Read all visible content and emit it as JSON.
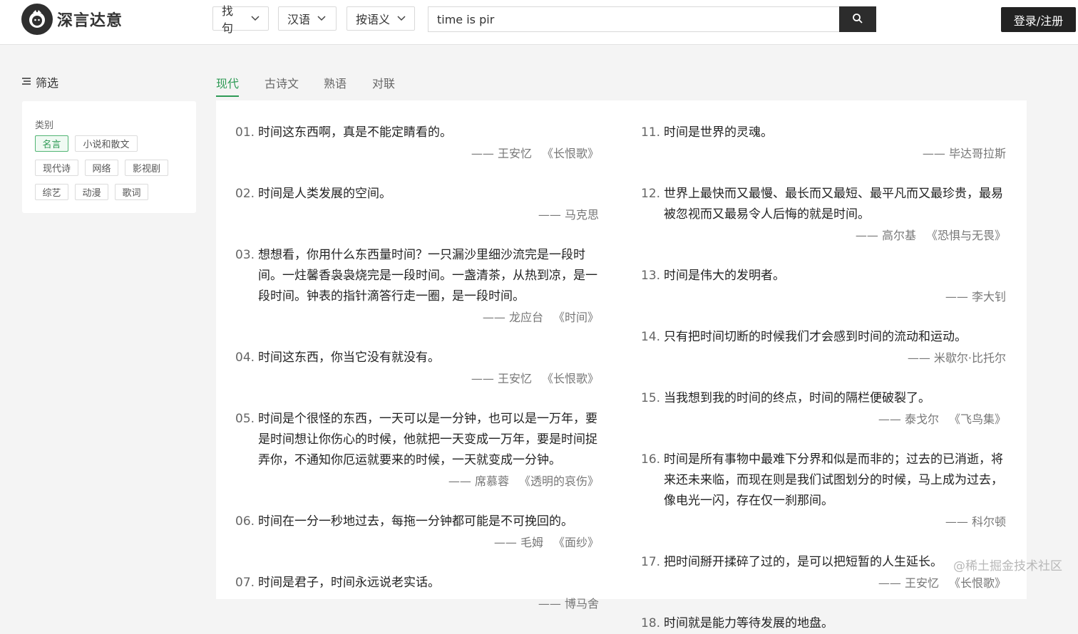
{
  "header": {
    "logo_text": "深言达意",
    "dropdowns": [
      "找句",
      "汉语",
      "按语义"
    ],
    "search_value": "time is pir",
    "login_label": "登录/注册"
  },
  "sidebar": {
    "filter_title": "筛选",
    "category_label": "类别",
    "tags": [
      {
        "label": "名言",
        "active": true
      },
      {
        "label": "小说和散文",
        "active": false
      },
      {
        "label": "现代诗",
        "active": false
      },
      {
        "label": "网络",
        "active": false
      },
      {
        "label": "影视剧",
        "active": false
      },
      {
        "label": "综艺",
        "active": false
      },
      {
        "label": "动漫",
        "active": false
      },
      {
        "label": "歌词",
        "active": false
      }
    ]
  },
  "tabs": [
    {
      "label": "现代",
      "active": true
    },
    {
      "label": "古诗文",
      "active": false
    },
    {
      "label": "熟语",
      "active": false
    },
    {
      "label": "对联",
      "active": false
    }
  ],
  "quotes_left": [
    {
      "num": "01.",
      "text": "时间这东西啊，真是不能定睛看的。",
      "author": "—— 王安忆",
      "book": "《长恨歌》"
    },
    {
      "num": "02.",
      "text": "时间是人类发展的空间。",
      "author": "—— 马克思",
      "book": ""
    },
    {
      "num": "03.",
      "text": "想想看，你用什么东西量时间？一只漏沙里细沙流完是一段时间。一炷馨香袅袅烧完是一段时间。一盏清茶，从热到凉，是一段时间。钟表的指针滴答行走一圈，是一段时间。",
      "author": "—— 龙应台",
      "book": "《时间》"
    },
    {
      "num": "04.",
      "text": "时间这东西，你当它没有就没有。",
      "author": "—— 王安忆",
      "book": "《长恨歌》"
    },
    {
      "num": "05.",
      "text": "时间是个很怪的东西，一天可以是一分钟，也可以是一万年，要是时间想让你伤心的时候，他就把一天变成一万年，要是时间捉弄你，不通知你厄运就要来的时候，一天就变成一分钟。",
      "author": "—— 席慕蓉",
      "book": "《透明的哀伤》"
    },
    {
      "num": "06.",
      "text": "时间在一分一秒地过去，每拖一分钟都可能是不可挽回的。",
      "author": "—— 毛姆",
      "book": "《面纱》"
    },
    {
      "num": "07.",
      "text": "时间是君子，时间永远说老实话。",
      "author": "—— 博马舍",
      "book": ""
    }
  ],
  "quotes_right": [
    {
      "num": "11.",
      "text": "时间是世界的灵魂。",
      "author": "—— 毕达哥拉斯",
      "book": ""
    },
    {
      "num": "12.",
      "text": "世界上最快而又最慢、最长而又最短、最平凡而又最珍贵，最易被忽视而又最易令人后悔的就是时间。",
      "author": "—— 高尔基",
      "book": "《恐惧与无畏》"
    },
    {
      "num": "13.",
      "text": "时间是伟大的发明者。",
      "author": "—— 李大钊",
      "book": ""
    },
    {
      "num": "14.",
      "text": "只有把时间切断的时候我们才会感到时间的流动和运动。",
      "author": "—— 米歇尔·比托尔",
      "book": ""
    },
    {
      "num": "15.",
      "text": "当我想到我的时间的终点，时间的隔栏便破裂了。",
      "author": "—— 泰戈尔",
      "book": "《飞鸟集》"
    },
    {
      "num": "16.",
      "text": "时间是所有事物中最难下分界和似是而非的；过去的已消逝，将来还未来临，而现在则是我们试图划分的时候，马上成为过去，像电光一闪，存在仅一刹那间。",
      "author": "—— 科尔顿",
      "book": ""
    },
    {
      "num": "17.",
      "text": "把时间掰开揉碎了过的，是可以把短暂的人生延长。",
      "author": "—— 王安忆",
      "book": "《长恨歌》"
    },
    {
      "num": "18.",
      "text": "时间就是能力等待发展的地盘。",
      "author": "",
      "book": ""
    }
  ],
  "watermark": "@稀土掘金技术社区"
}
